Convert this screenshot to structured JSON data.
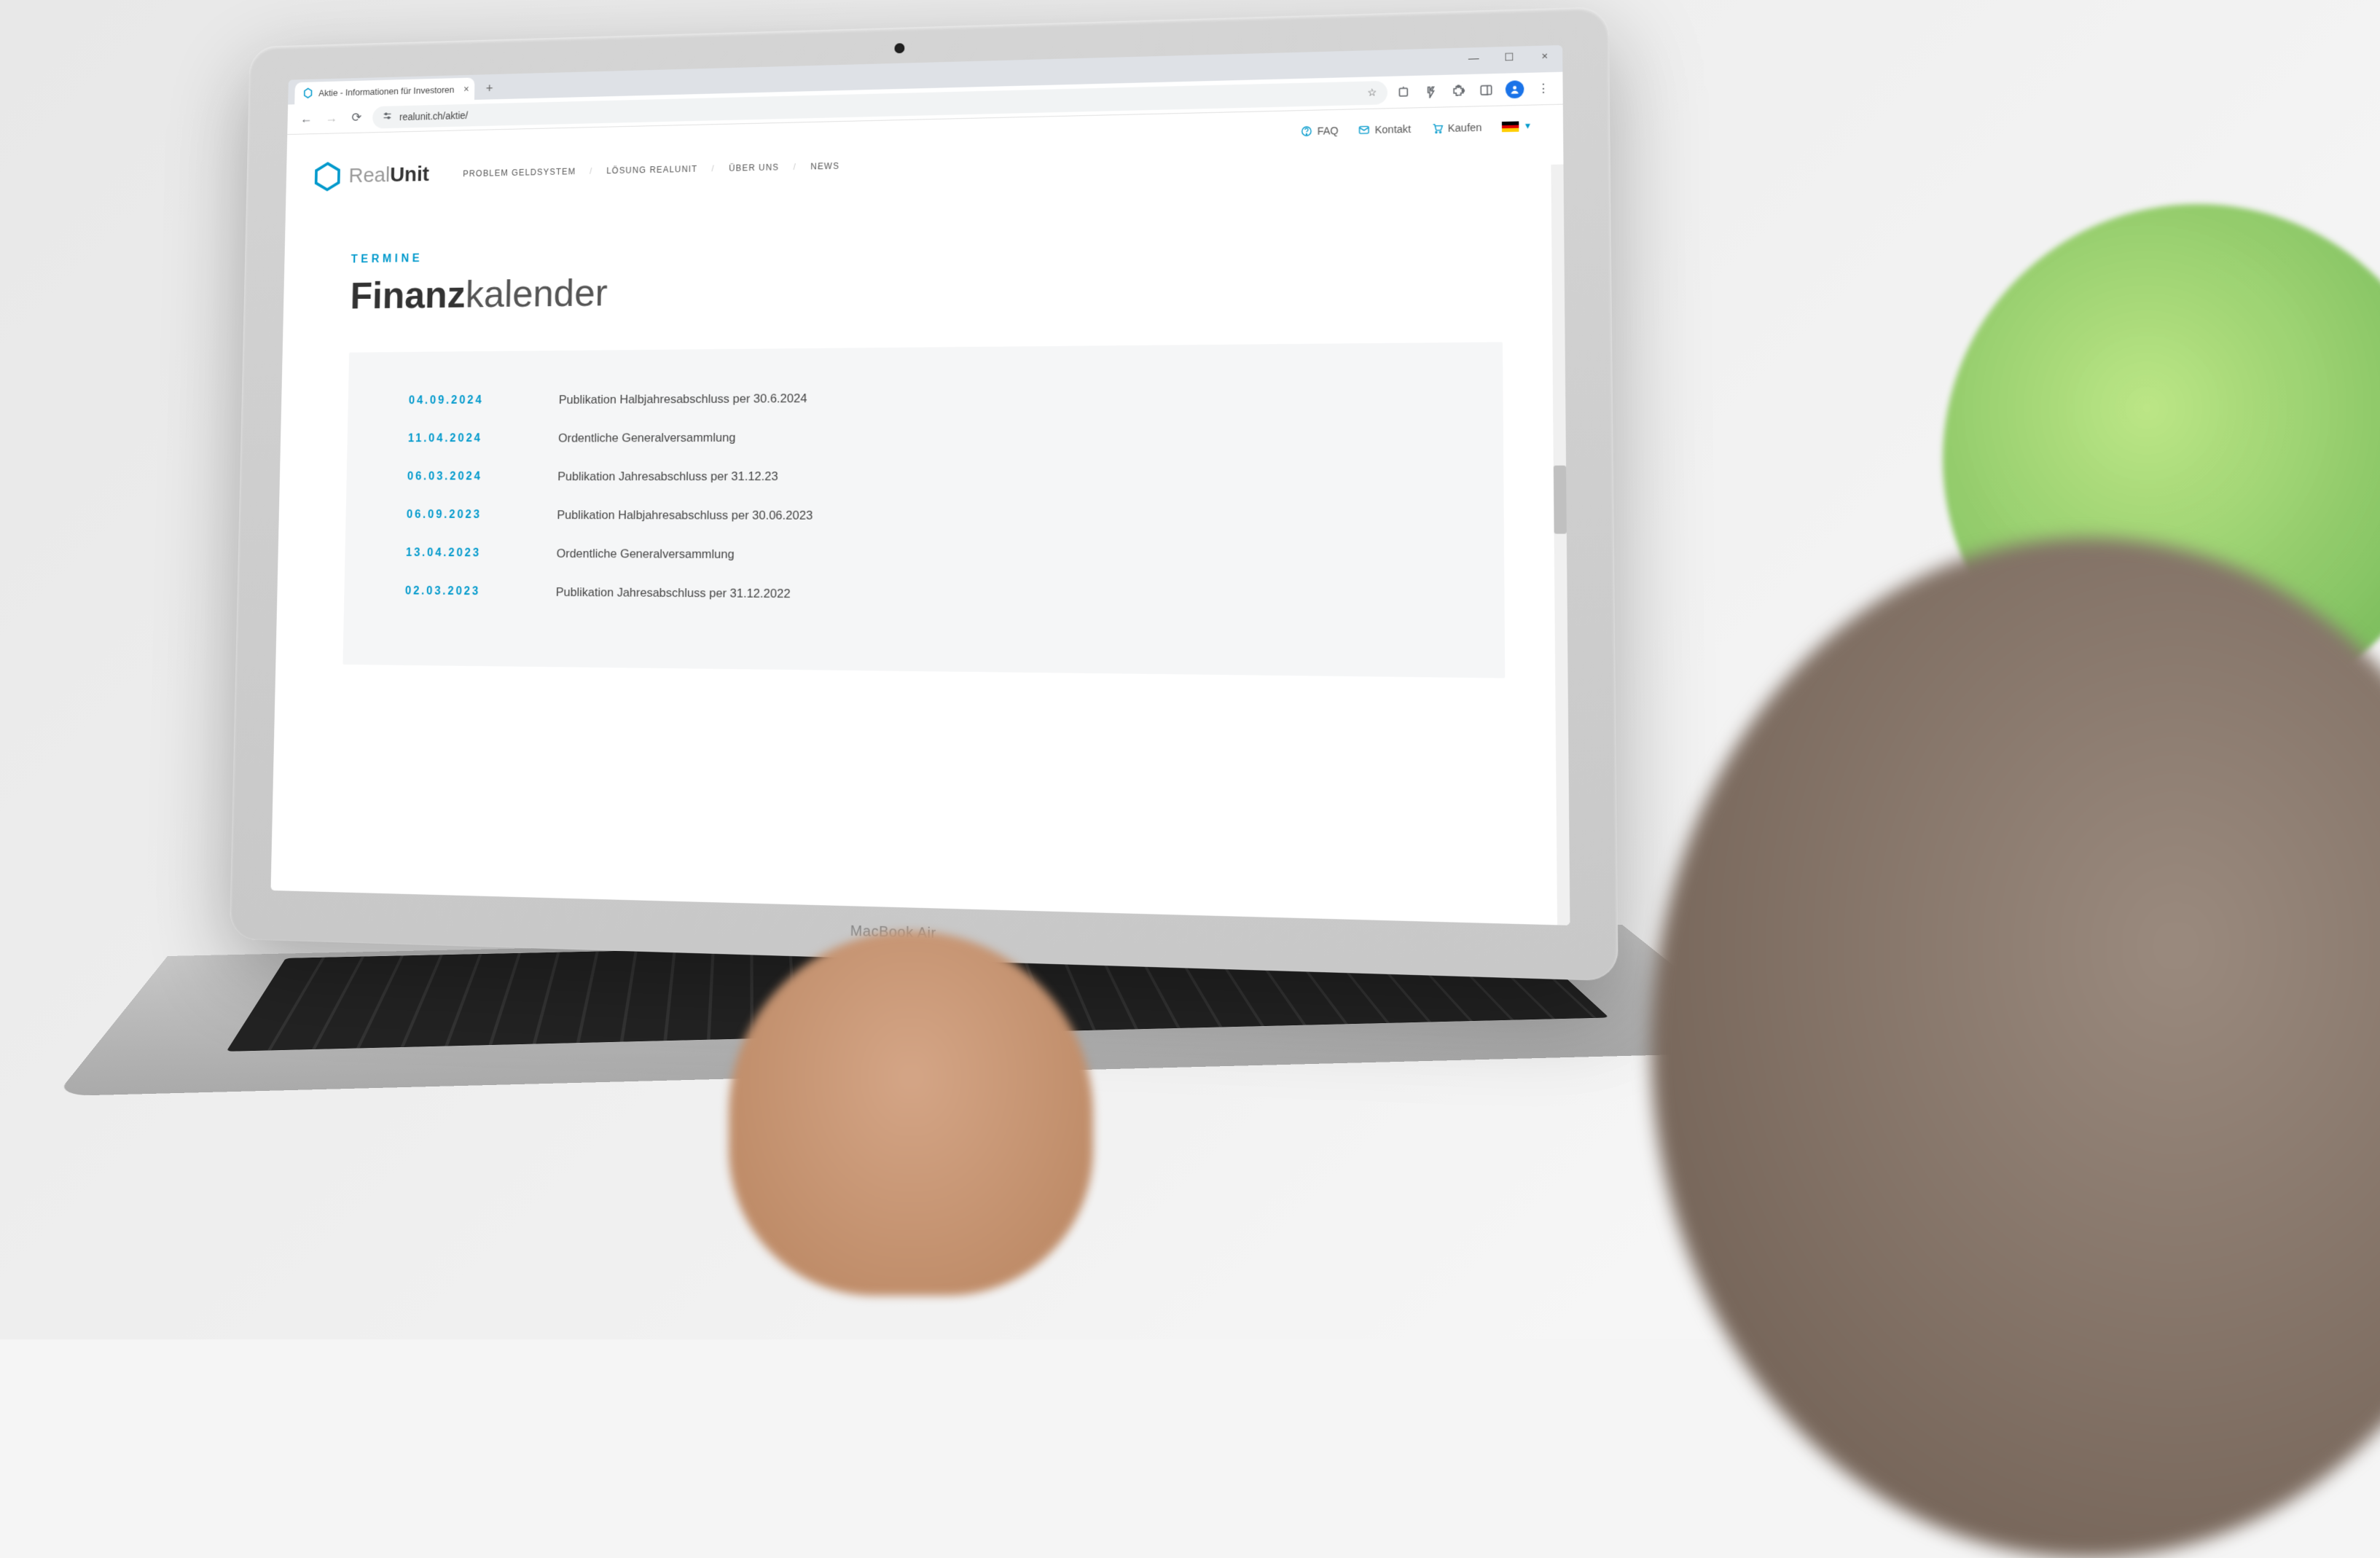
{
  "browser": {
    "tab_title": "Aktie - Informationen für Investoren",
    "url": "realunit.ch/aktie/"
  },
  "topbar": {
    "faq": "FAQ",
    "kontakt": "Kontakt",
    "kaufen": "Kaufen"
  },
  "logo": {
    "prefix": "Real",
    "suffix": "Unit"
  },
  "nav": {
    "item1": "PROBLEM GELDSYSTEM",
    "item2": "LÖSUNG REALUNIT",
    "item3": "ÜBER UNS",
    "item4": "NEWS"
  },
  "content": {
    "eyebrow": "TERMINE",
    "heading_bold": "Finanz",
    "heading_light": "kalender"
  },
  "calendar": [
    {
      "date": "04.09.2024",
      "desc": "Publikation Halbjahresabschluss per 30.6.2024"
    },
    {
      "date": "11.04.2024",
      "desc": "Ordentliche Generalversammlung"
    },
    {
      "date": "06.03.2024",
      "desc": "Publikation Jahresabschluss per 31.12.23"
    },
    {
      "date": "06.09.2023",
      "desc": "Publikation Halbjahresabschluss per 30.06.2023"
    },
    {
      "date": "13.04.2023",
      "desc": "Ordentliche Generalversammlung"
    },
    {
      "date": "02.03.2023",
      "desc": "Publikation Jahresabschluss per 31.12.2022"
    }
  ],
  "laptop_label": "MacBook Air"
}
